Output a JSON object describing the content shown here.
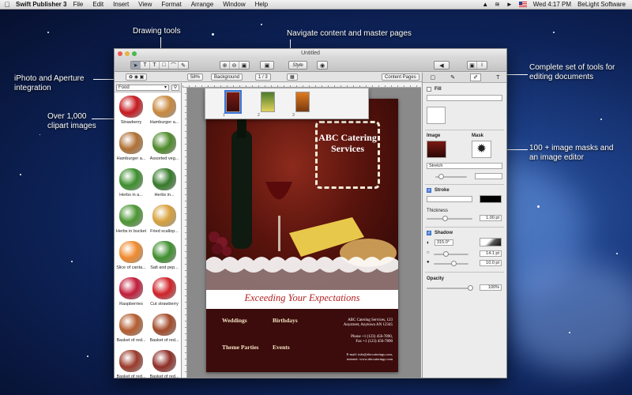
{
  "menubar": {
    "app_name": "Swift Publisher 3",
    "menus": [
      "File",
      "Edit",
      "Insert",
      "View",
      "Format",
      "Arrange",
      "Window",
      "Help"
    ],
    "clock": "Wed 4:17 PM",
    "user": "BeLight Software"
  },
  "callouts": {
    "drawing_tools": "Drawing tools",
    "navigate": "Navigate content and master pages",
    "iphoto": "iPhoto and Aperture integration",
    "tools": "Complete set of tools for editing documents",
    "clipart": "Over 1,000 clipart images",
    "masks": "100 + image masks and an image editor"
  },
  "window": {
    "title": "Untitled",
    "zoom": "58%",
    "background_menu": "Background",
    "page_indicator": "1 / 3",
    "content_pages": "Content Pages",
    "page_numbers": [
      "1",
      "2",
      "3"
    ]
  },
  "clipart": {
    "category": "Food",
    "items": [
      {
        "label": "Strawberry",
        "color": "#c8191f"
      },
      {
        "label": "Hamburger a...",
        "color": "#c9893e"
      },
      {
        "label": "Hamburger a...",
        "color": "#b07034"
      },
      {
        "label": "Assorted veg...",
        "color": "#4e8a2a"
      },
      {
        "label": "Herbs in a...",
        "color": "#3d8f2d"
      },
      {
        "label": "Herbs in...",
        "color": "#357a2a"
      },
      {
        "label": "Herbs in bucket",
        "color": "#4b9632"
      },
      {
        "label": "Fried scallop...",
        "color": "#d8a13c"
      },
      {
        "label": "Slice of canta...",
        "color": "#f08a2e"
      },
      {
        "label": "Salt and pep...",
        "color": "#3f8f2e"
      },
      {
        "label": "Raspberries",
        "color": "#c31b3a"
      },
      {
        "label": "Cut strawberry",
        "color": "#d02127"
      },
      {
        "label": "Basket of red...",
        "color": "#b45c2e"
      },
      {
        "label": "Basket of red...",
        "color": "#a34a28"
      },
      {
        "label": "Basket of red...",
        "color": "#9a3a2a"
      },
      {
        "label": "Basket of red...",
        "color": "#8f2e26"
      }
    ]
  },
  "flyer": {
    "frame_title": "ABC Catering Services",
    "tagline": "Exceeding Your Expectations",
    "headings": [
      "Weddings",
      "Birthdays",
      "Theme Parties",
      "Events"
    ],
    "address_lines": [
      "ABC Catering Services, 123",
      "Anystreet, Anytown AN 12345"
    ],
    "phone_lines": [
      "Phone +1 (123) 456-7890,",
      "Fax +1 (123) 456-7890"
    ],
    "email_lines": [
      "E-mail: info@abccaterings.com,",
      "internet: www.abccaterings.com"
    ]
  },
  "inspector": {
    "fill_label": "Fill",
    "image_label": "Image",
    "mask_label": "Mask",
    "scale_mode": "Stretch",
    "stroke_label": "Stroke",
    "thickness_label": "Thickness",
    "thickness_value": "1.00 pt",
    "shadow_label": "Shadow",
    "shadow_angle": "315.0°",
    "shadow_offset": "14.1 pt",
    "shadow_blur": "10.0 pt",
    "opacity_label": "Opacity",
    "opacity_value": "100%"
  }
}
